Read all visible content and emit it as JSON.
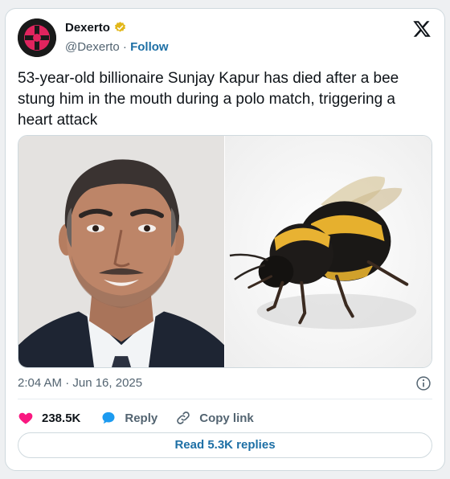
{
  "account": {
    "display_name": "Dexerto",
    "handle": "@Dexerto",
    "separator": "·",
    "follow_label": "Follow",
    "verified_icon": "verified-gold-badge-icon",
    "avatar_icon": "dexerto-logo-icon"
  },
  "platform_icon": "x-logo-icon",
  "tweet": {
    "text": "53-year-old billionaire Sunjay Kapur has died after a bee stung him in the mouth during a polo match, triggering a heart attack"
  },
  "media": {
    "images": [
      "man-portrait-photo",
      "bumblebee-photo"
    ]
  },
  "meta": {
    "timestamp": "2:04 AM · Jun 16, 2025"
  },
  "actions": {
    "likes": "238.5K",
    "reply_label": "Reply",
    "copy_link_label": "Copy link"
  },
  "replies_button": "Read 5.3K replies",
  "colors": {
    "accent_blue": "#1d6fa5",
    "like_pink": "#f91880",
    "reply_blue": "#1d9bf0",
    "muted": "#536471",
    "border": "#cfd9de"
  }
}
